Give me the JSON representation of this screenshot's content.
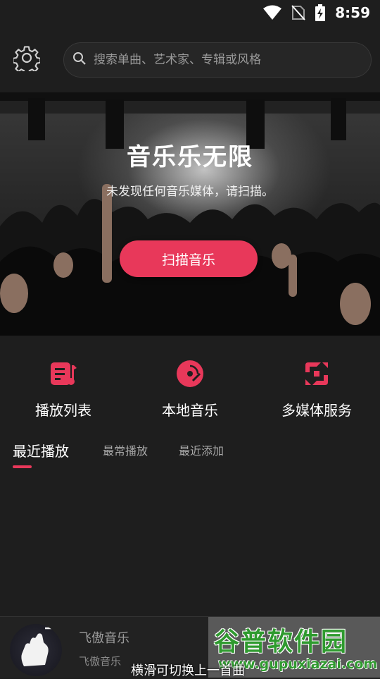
{
  "status_bar": {
    "time": "8:59",
    "icons": [
      "wifi-icon",
      "no-sim-icon",
      "battery-charging-icon"
    ]
  },
  "search": {
    "placeholder": "搜索单曲、艺术家、专辑或风格",
    "value": ""
  },
  "banner": {
    "title": "音乐乐无限",
    "subtitle": "未发现任何音乐媒体，请扫描。",
    "scan_button": "扫描音乐"
  },
  "quick_actions": [
    {
      "label": "播放列表",
      "icon": "playlist-icon"
    },
    {
      "label": "本地音乐",
      "icon": "disc-icon"
    },
    {
      "label": "多媒体服务",
      "icon": "media-service-icon"
    }
  ],
  "tabs": [
    {
      "label": "最近播放",
      "active": true
    },
    {
      "label": "最常播放",
      "active": false
    },
    {
      "label": "最近添加",
      "active": false
    }
  ],
  "player": {
    "title": "飞傲音乐",
    "artist": "飞傲音乐",
    "hint": "横滑可切换上一首曲"
  },
  "watermark": {
    "name": "谷普软件园",
    "url": "www.gupuxiazai.com"
  },
  "colors": {
    "accent": "#e8385a",
    "background": "#1e1e1e"
  }
}
